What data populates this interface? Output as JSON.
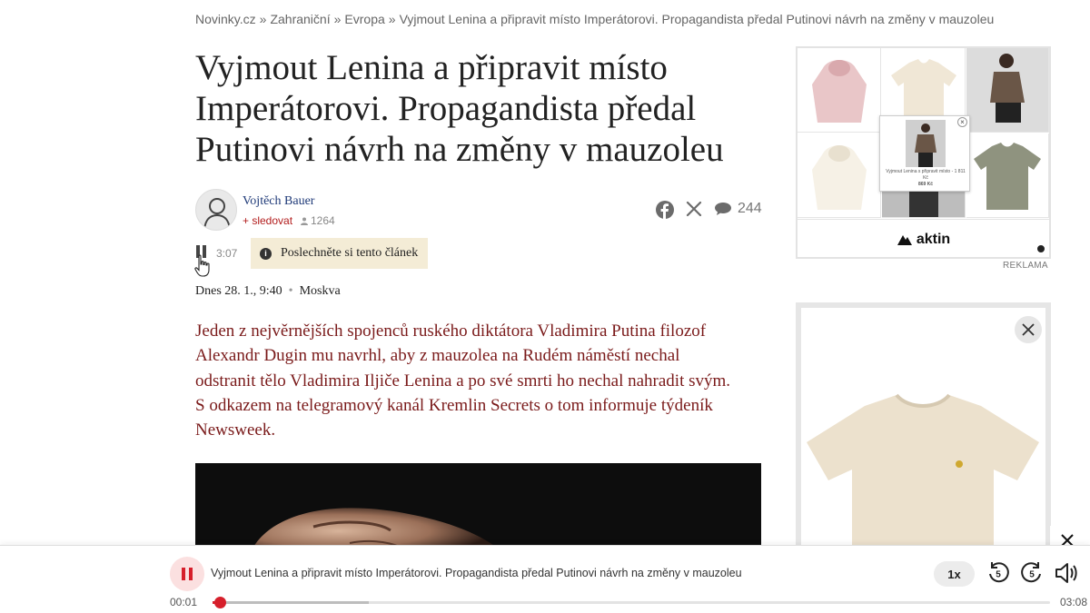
{
  "breadcrumb": {
    "items": [
      "Novinky.cz",
      "Zahraniční",
      "Evropa",
      "Vyjmout Lenina a připravit místo Imperátorovi. Propagandista předal Putinovi návrh na změny v mauzoleu"
    ],
    "separator": "»"
  },
  "article": {
    "title_lines": [
      "Vyjmout Lenina a připravit místo",
      "Imperátorovi. Propagandista předal",
      "Putinovi návrh na změny v mauzoleu"
    ],
    "author": {
      "name": "Vojtěch Bauer",
      "follow_label": "+ sledovat",
      "followers": "1264"
    },
    "share": {
      "facebook_icon": "facebook-icon",
      "x_icon": "x-icon",
      "comments_icon": "comments-icon",
      "comment_count": "244"
    },
    "listen": {
      "duration": "3:07",
      "label": "Poslechněte si tento článek"
    },
    "date": "Dnes 28. 1., 9:40",
    "location": "Moskva",
    "perex_lines": [
      "Jeden z nejvěrnějších spojenců ruského diktátora Vladimira Putina filozof",
      "Alexandr Dugin mu navrhl, aby z mauzolea na Rudém náměstí nechal",
      "odstranit tělo Vladimira Iljiče Lenina a po své smrti ho nechal nahradit svým.",
      "S odkazem na telegramový kanál Kremlin Secrets o tom informuje týdeník",
      "Newsweek."
    ]
  },
  "ads": {
    "top": {
      "brand": "aktin",
      "label": "REKLAMA",
      "popup_text": "Vyjmout Lenina s připravit místo - 1 811 Kč",
      "popup_price": "869 Kč"
    }
  },
  "player": {
    "title": "Vyjmout Lenina a připravit místo Imperátorovi. Propagandista předal Putinovi návrh na změny v mauzoleu",
    "speed": "1x",
    "rewind_seconds": "5",
    "forward_seconds": "5",
    "current_time": "00:01",
    "total_time": "03:08",
    "progress_fraction": 0.005
  },
  "colors": {
    "accent_red": "#d61f2b",
    "perex_text": "#7a1a1a",
    "author_link": "#1f3a78",
    "listen_bg": "#f4ecd6"
  }
}
